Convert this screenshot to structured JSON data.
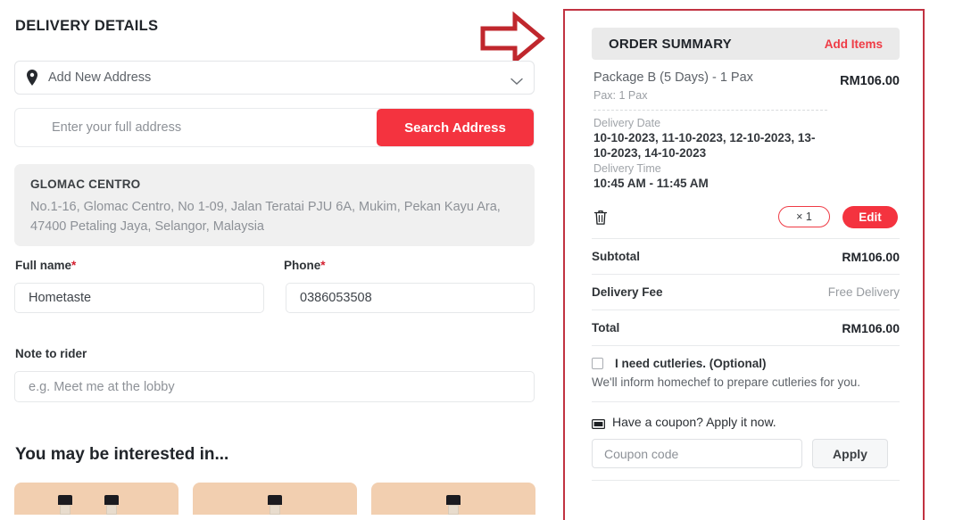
{
  "left": {
    "section_title": "DELIVERY DETAILS",
    "address_select": {
      "icon": "location-pin-icon",
      "value": "Add New Address",
      "chevron": "chevron-down-icon"
    },
    "search": {
      "placeholder": "Enter your full address",
      "button_label": "Search Address"
    },
    "saved_address": {
      "name": "GLOMAC CENTRO",
      "line": "No.1-16, Glomac Centro, No 1-09, Jalan Teratai PJU 6A, Mukim, Pekan Kayu Ara, 47400 Petaling Jaya, Selangor, Malaysia"
    },
    "fullname": {
      "label": "Full name",
      "required_mark": "*",
      "value": "Hometaste"
    },
    "phone": {
      "label": "Phone",
      "required_mark": "*",
      "value": "0386053508"
    },
    "note": {
      "label": "Note to rider",
      "placeholder": "e.g. Meet me at the lobby"
    },
    "interested_title": "You may be interested in...",
    "product_cards": [
      {
        "name": "product-card-1",
        "bottles": 2
      },
      {
        "name": "product-card-2",
        "bottles": 1
      },
      {
        "name": "product-card-3",
        "bottles": 1
      }
    ]
  },
  "summary": {
    "title": "ORDER SUMMARY",
    "add_items_label": "Add Items",
    "item": {
      "name": "Package B (5 Days) - 1 Pax",
      "pax": "Pax: 1 Pax",
      "delivery_date_label": "Delivery Date",
      "delivery_date_value": "10-10-2023, 11-10-2023, 12-10-2023, 13-10-2023, 14-10-2023",
      "delivery_time_label": "Delivery Time",
      "delivery_time_value": "10:45 AM - 11:45 AM",
      "price": "RM106.00",
      "qty_badge": "× 1",
      "edit_label": "Edit",
      "delete_icon": "trash-icon"
    },
    "totals": [
      {
        "label": "Subtotal",
        "value": "RM106.00",
        "muted": false
      },
      {
        "label": "Delivery Fee",
        "value": "Free Delivery",
        "muted": true
      },
      {
        "label": "Total",
        "value": "RM106.00",
        "muted": false
      }
    ],
    "cutleries": {
      "label": "I need cutleries. (Optional)",
      "sub": "We'll inform homechef to prepare cutleries for you.",
      "checked": false
    },
    "coupon": {
      "icon": "ticket-icon",
      "heading": "Have a coupon? Apply it now.",
      "placeholder": "Coupon code",
      "apply_label": "Apply"
    }
  },
  "annotation": {
    "arrow": "right-arrow-annotation",
    "arrow_color": "#c0272d",
    "highlight_border_color": "#c13241"
  },
  "colors": {
    "primary_red": "#f4333f",
    "link_red": "#ef3b45",
    "card_peach": "#f2cfb0",
    "header_grey": "#eaeaea"
  }
}
